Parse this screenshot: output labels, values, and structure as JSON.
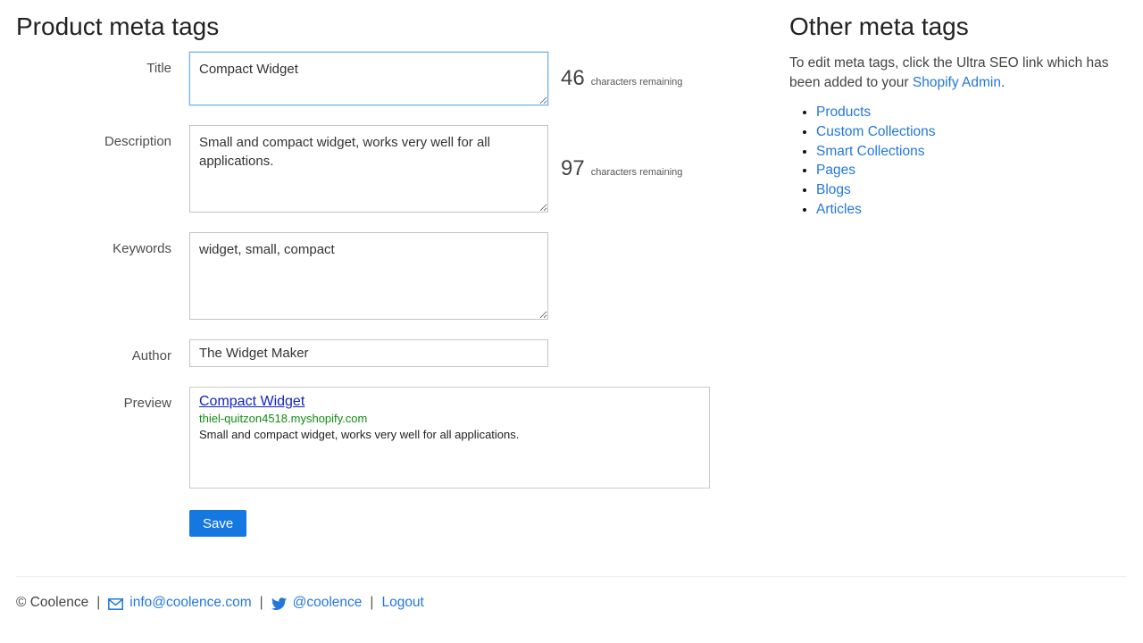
{
  "main": {
    "title": "Product meta tags",
    "fields": {
      "title": {
        "label": "Title",
        "value": "Compact Widget",
        "counter": "46",
        "counter_suffix": "characters remaining"
      },
      "description": {
        "label": "Description",
        "value": "Small and compact widget, works very well for all applications.",
        "counter": "97",
        "counter_suffix": "characters remaining"
      },
      "keywords": {
        "label": "Keywords",
        "value": "widget, small, compact"
      },
      "author": {
        "label": "Author",
        "value": "The Widget Maker"
      }
    },
    "preview": {
      "label": "Preview",
      "result_title": "Compact Widget",
      "result_url": "thiel-quitzon4518.myshopify.com",
      "result_description": "Small and compact widget, works very well for all applications."
    },
    "save_label": "Save"
  },
  "sidebar": {
    "title": "Other meta tags",
    "intro_text": "To edit meta tags, click the Ultra SEO link which has been added to your ",
    "intro_link_label": "Shopify Admin",
    "intro_suffix": ".",
    "links": [
      "Products",
      "Custom Collections",
      "Smart Collections",
      "Pages",
      "Blogs",
      "Articles"
    ]
  },
  "footer": {
    "copyright": "© Coolence",
    "separator": "|",
    "email_label": "info@coolence.com",
    "twitter_label": "@coolence",
    "logout_label": "Logout"
  },
  "icons": {
    "email": "envelope-icon",
    "twitter": "twitter-bird-icon"
  },
  "colors": {
    "link_blue": "#2277dd",
    "save_button_blue": "#1577e0",
    "focused_field_border": "#6fb3e8",
    "preview_title_blue": "#1122cc",
    "preview_url_green": "#118c11",
    "heading_text": "#222222",
    "body_text": "#434343",
    "field_border": "#c3c3c3"
  }
}
